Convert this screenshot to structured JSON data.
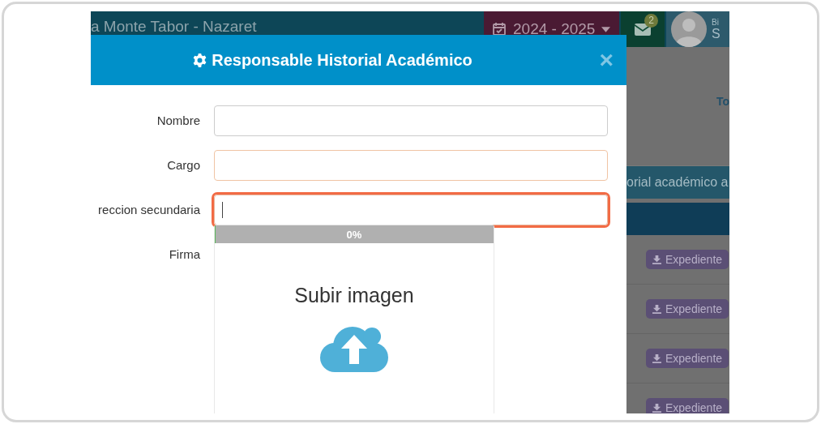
{
  "topbar": {
    "school": "a Monte Tabor - Nazaret",
    "year": "2024 - 2025",
    "mail_badge": "2",
    "user_line_1": "Bi",
    "user_line_2": "S"
  },
  "background": {
    "link": "To",
    "banner": "orial académico a",
    "row_buttons": [
      "Expediente",
      "Expediente",
      "Expediente",
      "Expediente"
    ]
  },
  "modal": {
    "title": "Responsable Historial Académico",
    "close": "×",
    "fields": [
      {
        "label": "Nombre",
        "kind": "text",
        "highlighted": false,
        "focused": false
      },
      {
        "label": "Cargo",
        "kind": "text",
        "highlighted": true,
        "focused": false
      },
      {
        "label": "reccion secundaria",
        "kind": "text",
        "highlighted": false,
        "focused": true
      },
      {
        "label": "Firma",
        "kind": "upload",
        "progress_label": "0%",
        "level": 0,
        "prompt": "Subir imagen"
      }
    ]
  }
}
